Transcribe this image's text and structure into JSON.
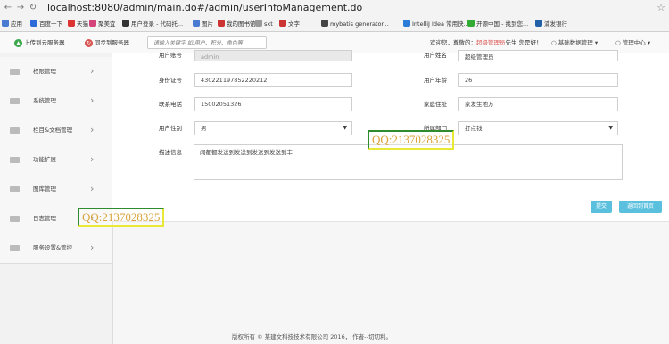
{
  "browser": {
    "url": "localhost:8080/admin/main.do#/admin/userInfoManagement.do",
    "bookmarks": [
      {
        "label": "应用",
        "color": "#4a7bd3"
      },
      {
        "label": "百度一下",
        "color": "#2c6bd8"
      },
      {
        "label": "天猫",
        "color": "#d33"
      },
      {
        "label": "聚美宜",
        "color": "#d4437a"
      },
      {
        "label": "用户登录 - 代码托...",
        "color": "#333"
      },
      {
        "label": "图片",
        "color": "#4a7bd3"
      },
      {
        "label": "我的图书馆",
        "color": "#c33"
      },
      {
        "label": "sxt",
        "color": "#999"
      },
      {
        "label": "文字",
        "color": "#c33"
      },
      {
        "label": "mybatis generator...",
        "color": "#444"
      },
      {
        "label": "IntelliJ Idea 常用快...",
        "color": "#2b7bd8"
      },
      {
        "label": "开源中国 - 找到您...",
        "color": "#3a3"
      },
      {
        "label": "浦发银行",
        "color": "#2260a8"
      }
    ]
  },
  "header": {
    "upload_label": "上传到云服务器",
    "sync_label": "同步到服务器",
    "search_placeholder": "请输入关键字 如:用户、积分、角色等",
    "welcome_prefix": "欢迎您，尊敬的：",
    "welcome_role": "超级管理员",
    "welcome_suffix": "先生 您是好！",
    "menu_basic": "基础数据管理",
    "menu_admin": "管理中心"
  },
  "sidebar": {
    "items": [
      {
        "label": "权限管理"
      },
      {
        "label": "系统管理"
      },
      {
        "label": "栏目&文档管理"
      },
      {
        "label": "功能扩展"
      },
      {
        "label": "图库管理"
      },
      {
        "label": "日志管理"
      },
      {
        "label": "服务设置&管控"
      }
    ]
  },
  "form": {
    "account_label": "用户账号",
    "account_value": "admin",
    "name_label": "用户姓名",
    "name_value": "超级管理员",
    "idcard_label": "身份证号",
    "idcard_value": "430221197852220212",
    "age_label": "用户年龄",
    "age_value": "26",
    "phone_label": "联系电话",
    "phone_value": "15002051326",
    "address_label": "家庭住址",
    "address_value": "家发生地方",
    "gender_label": "用户性别",
    "gender_value": "男",
    "dept_label": "所属部门",
    "dept_value": "打点钱",
    "desc_label": "描述信息",
    "desc_value": "闻都都发送到发送到发送到发送到丰",
    "submit_label": "提交",
    "back_label": "返回到首页"
  },
  "watermarks": [
    "QQ:2137028325",
    "QQ:2137028325"
  ],
  "footer": "版权所有 © 某建文科技技术有限公司 2016，  作者--切切利。"
}
